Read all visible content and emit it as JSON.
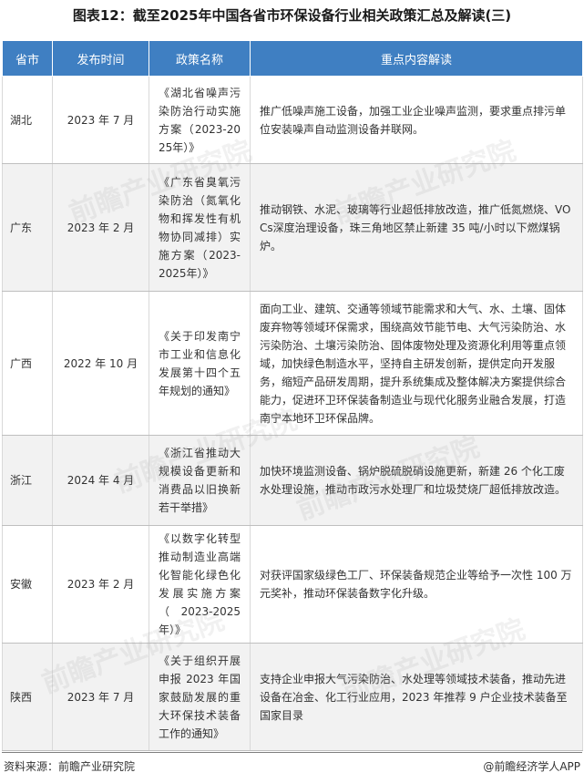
{
  "title": "图表12：截至2025年中国各省市环保设备行业相关政策汇总及解读(三)",
  "table": {
    "headers": [
      "省市",
      "发布时间",
      "政策名称",
      "重点内容解读"
    ],
    "rows": [
      {
        "province": "湖北",
        "date": "2023 年 7 月",
        "policy": "《湖北省噪声污染防治行动实施方案（2023-2025年）》",
        "interpretation": "推广低噪声施工设备，加强工业企业噪声监测，要求重点排污单位安装噪声自动监测设备并联网。"
      },
      {
        "province": "广东",
        "date": "2023 年 2 月",
        "policy": "《广东省臭氧污染防治（氮氧化物和挥发性有机物协同减排）实施方案（2023-2025年）》",
        "interpretation": "推动钢铁、水泥、玻璃等行业超低排放改造，推广低氮燃烧、VOCs深度治理设备，珠三角地区禁止新建 35 吨/小时以下燃煤锅炉。"
      },
      {
        "province": "广西",
        "date": "2022 年 10 月",
        "policy": "《关于印发南宁市工业和信息化发展第十四个五年规划的通知》",
        "interpretation": "面向工业、建筑、交通等领域节能需求和大气、水、土壤、固体废弃物等领域环保需求，围绕高效节能节电、大气污染防治、水污染防治、土壤污染防治、固体废物处理及资源化利用等重点领域，加快绿色制造水平，坚持自主研发创新，提供定向开发服务，缩短产品研发周期，提升系统集成及整体解决方案提供综合能力，促进环卫环保装备制造业与现代化服务业融合发展，打造南宁本地环卫环保品牌。"
      },
      {
        "province": "浙江",
        "date": "2024 年 4 月",
        "policy": "《浙江省推动大规模设备更新和消费品以旧换新若干举措》",
        "interpretation": "加快环境监测设备、锅炉脱硫脱硝设施更新，新建 26 个化工废水处理设施，推动市政污水处理厂和垃圾焚烧厂超低排放改造。"
      },
      {
        "province": "安徽",
        "date": "2023 年 2 月",
        "policy": "《以数字化转型推动制造业高端化智能化绿色化发展实施方案（2023-2025年）》",
        "interpretation": "对获评国家级绿色工厂、环保装备规范企业等给予一次性 100 万元奖补，推动环保装备数字化升级。"
      },
      {
        "province": "陕西",
        "date": "2023 年 7 月",
        "policy": "《关于组织开展申报 2023 年国家鼓励发展的重大环保技术装备工作的通知》",
        "interpretation": "支持企业申报大气污染防治、水处理等领域技术装备，推动先进设备在冶金、化工行业应用，2023 年推荐 9 户企业技术装备至国家目录"
      }
    ]
  },
  "footer": {
    "source": "资料来源：前瞻产业研究院",
    "brand": "@前瞻经济学人APP"
  },
  "watermark": "前瞻产业研究院"
}
